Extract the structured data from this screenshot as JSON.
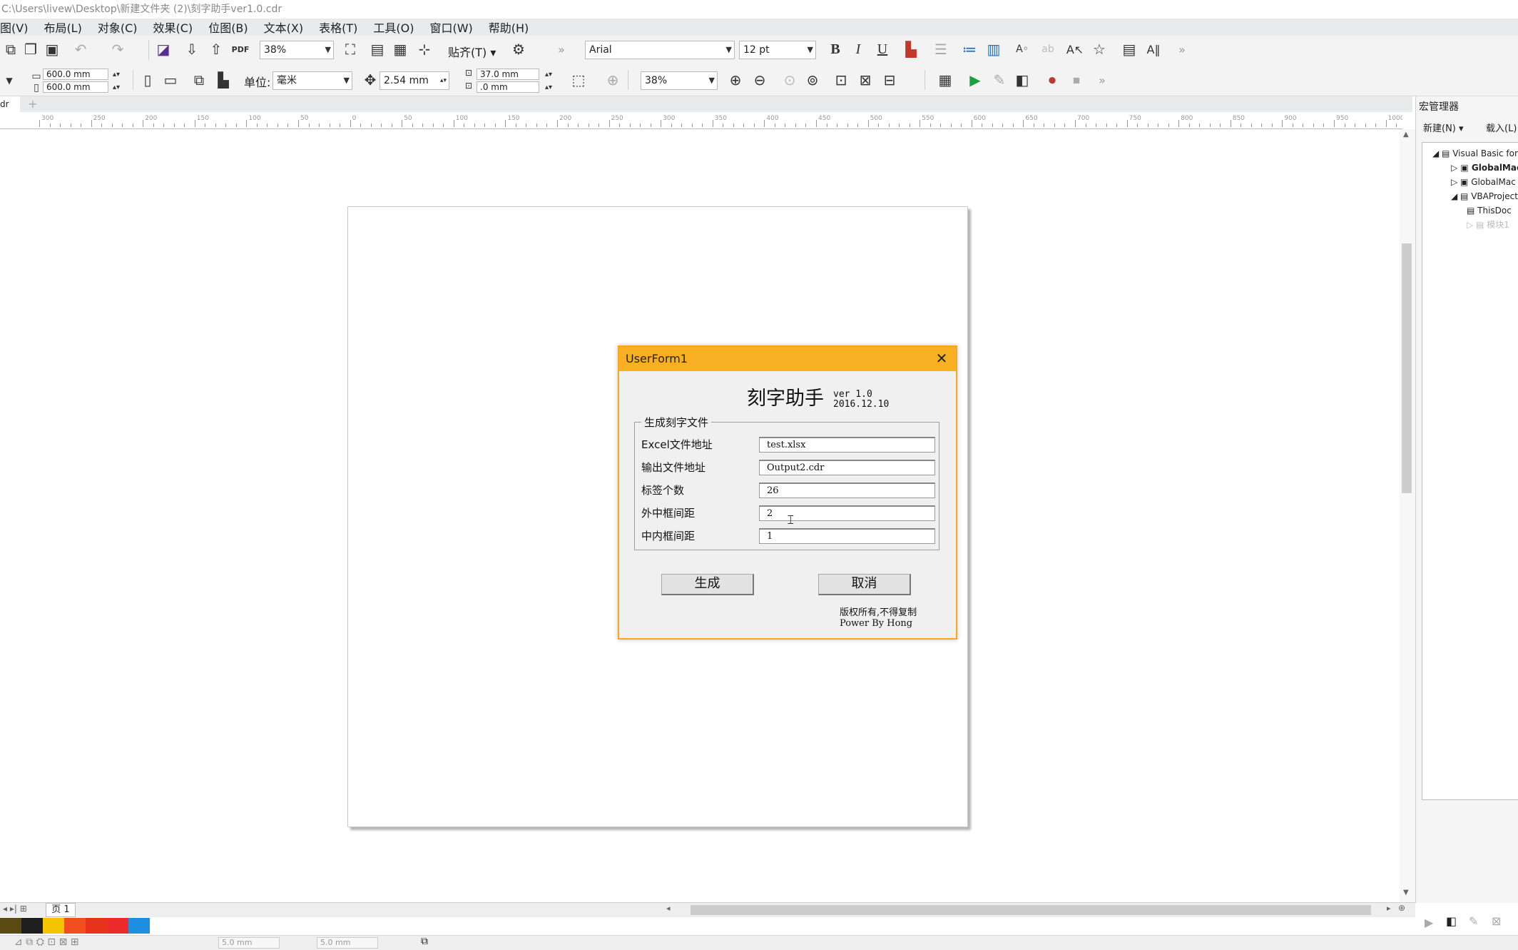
{
  "window": {
    "title": "C:\\Users\\livew\\Desktop\\新建文件夹 (2)\\刻字助手ver1.0.cdr"
  },
  "menu": [
    "图(V)",
    "布局(L)",
    "对象(C)",
    "效果(C)",
    "位图(B)",
    "文本(X)",
    "表格(T)",
    "工具(O)",
    "窗口(W)",
    "帮助(H)"
  ],
  "toolbar1": {
    "zoom": "38%",
    "snap_label": "贴齐(T)",
    "font": "Arial",
    "font_size": "12 pt"
  },
  "toolbar2": {
    "width": "600.0 mm",
    "height": "600.0 mm",
    "unit_label": "单位:",
    "unit_value": "毫米",
    "nudge": "2.54 mm",
    "dup_x": "37.0 mm",
    "dup_y": ".0 mm",
    "zoom": "38%"
  },
  "doc_tab": "dr",
  "ruler_labels": [
    "300",
    "250",
    "200",
    "150",
    "100",
    "50",
    "0",
    "50",
    "100",
    "150",
    "200",
    "250",
    "300",
    "350",
    "400",
    "450",
    "500",
    "550",
    "600",
    "650",
    "700",
    "750",
    "800",
    "850",
    "900",
    "950",
    "1000"
  ],
  "docker": {
    "title": "宏管理器",
    "new_btn": "新建(N)",
    "load_btn": "载入(L)",
    "tree": [
      "Visual Basic for",
      "GlobalMac",
      "GlobalMac",
      "VBAProject",
      "ThisDoc",
      "模块1"
    ]
  },
  "page_tab": "页 1",
  "status": {
    "field1": "5.0 mm",
    "field2": "5.0 mm"
  },
  "palette": [
    "#5b4a12",
    "#1e1e1e",
    "#f5c400",
    "#f04e1f",
    "#e8331c",
    "#ee2b2b",
    "#1e8ee0"
  ],
  "dialog": {
    "title": "UserForm1",
    "heading": "刻字助手",
    "version": "ver 1.0\n2016.12.10",
    "group_title": "生成刻字文件",
    "fields": [
      {
        "label": "Excel文件地址",
        "value": "test.xlsx"
      },
      {
        "label": "输出文件地址",
        "value": "Output2.cdr"
      },
      {
        "label": "标签个数",
        "value": "26"
      },
      {
        "label": "外中框间距",
        "value": "2"
      },
      {
        "label": "中内框间距",
        "value": "1"
      }
    ],
    "generate_btn": "生成",
    "cancel_btn": "取消",
    "copyright": "版权所有,不得复制\nPower By Hong"
  }
}
